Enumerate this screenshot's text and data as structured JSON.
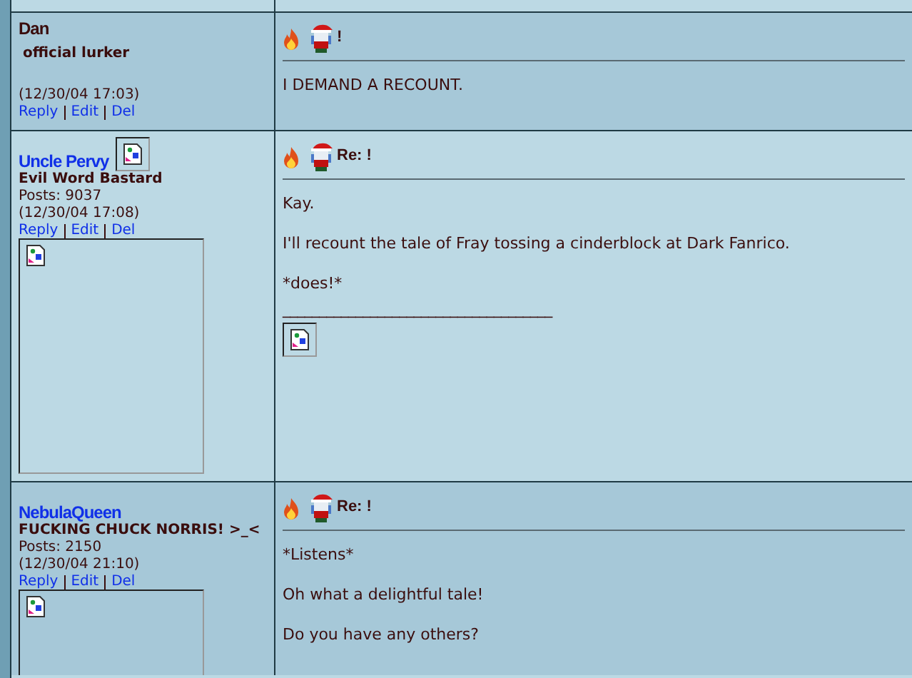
{
  "posts": [
    {
      "author": "Dan",
      "author_link": false,
      "title": "official lurker",
      "time": "(12/30/04 17:03)",
      "actions": [
        "Reply",
        "Edit",
        "Del"
      ],
      "header_icon": false,
      "avatar": false,
      "subject": "!",
      "body": [
        "I DEMAND A RECOUNT."
      ]
    },
    {
      "author": "Uncle Pervy",
      "author_link": true,
      "title": "Evil Word Bastard",
      "posts": "Posts: 9037",
      "time": "(12/30/04 17:08)",
      "actions": [
        "Reply",
        "Edit",
        "Del"
      ],
      "header_icon": true,
      "avatar": true,
      "subject": "Re: !",
      "body": [
        "Kay.",
        "I'll recount the tale of Fray tossing a cinderblock at Dark Fanrico.",
        "*does!*"
      ],
      "signature": "_____________________________________"
    },
    {
      "author": "NebulaQueen",
      "author_link": true,
      "title": "FUCKING CHUCK NORRIS! >_<",
      "posts": "Posts: 2150",
      "time": "(12/30/04 21:10)",
      "actions": [
        "Reply",
        "Edit",
        "Del"
      ],
      "header_icon": false,
      "avatar": true,
      "subject": "Re: !",
      "body": [
        "*Listens*",
        "Oh what a delightful tale!",
        "Do you have any others?"
      ]
    }
  ]
}
